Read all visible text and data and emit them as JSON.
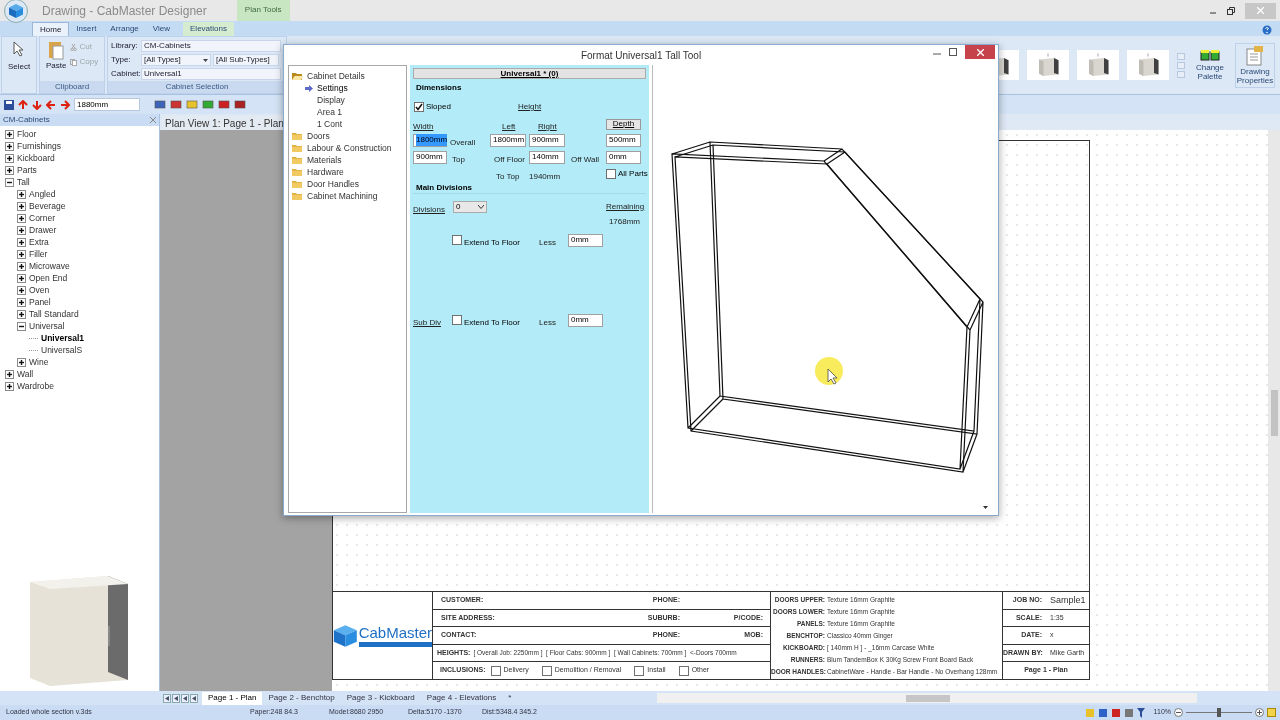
{
  "window": {
    "title": "Drawing - CabMaster Designer",
    "context_tab": "Plan Tools"
  },
  "ribbon_tabs": [
    {
      "label": "Home",
      "selected": true
    },
    {
      "label": "Insert",
      "selected": false
    },
    {
      "label": "Arrange",
      "selected": false
    },
    {
      "label": "View",
      "selected": false
    },
    {
      "label": "Elevations",
      "selected": false
    }
  ],
  "ribbon": {
    "select": "Select",
    "paste": "Paste",
    "cut": "Cut",
    "copy": "Copy",
    "clipboard_group": "Clipboard",
    "library_label": "Library:",
    "library": "CM-Cabinets",
    "type_label": "Type:",
    "type": "[All Types]",
    "subtype": "[All Sub-Types]",
    "cabinet_label": "Cabinet:",
    "cabinet": "Universal1",
    "selection_group": "Cabinet Selection",
    "change_palette": "Change Palette",
    "drawing_properties": "Drawing Properties"
  },
  "toolbar": {
    "size": "1880mm"
  },
  "tree_panel": {
    "title": "CM-Cabinets",
    "items": [
      {
        "label": "Floor",
        "kind": "folder",
        "expanded": false,
        "selected": false
      },
      {
        "label": "Furnishings",
        "kind": "folder",
        "expanded": false,
        "selected": false
      },
      {
        "label": "Kickboard",
        "kind": "folder",
        "expanded": false,
        "selected": false
      },
      {
        "label": "Parts",
        "kind": "folder",
        "expanded": false,
        "selected": false
      },
      {
        "label": "Tall",
        "kind": "folder",
        "expanded": true,
        "selected": false,
        "children": [
          {
            "label": "Angled",
            "kind": "folder",
            "expanded": false,
            "selected": false
          },
          {
            "label": "Beverage",
            "kind": "folder",
            "expanded": false,
            "selected": false
          },
          {
            "label": "Corner",
            "kind": "folder",
            "expanded": false,
            "selected": false
          },
          {
            "label": "Drawer",
            "kind": "folder",
            "expanded": false,
            "selected": false
          },
          {
            "label": "Extra",
            "kind": "folder",
            "expanded": false,
            "selected": false
          },
          {
            "label": "Filler",
            "kind": "folder",
            "expanded": false,
            "selected": false
          },
          {
            "label": "Microwave",
            "kind": "folder",
            "expanded": false,
            "selected": false
          },
          {
            "label": "Open End",
            "kind": "folder",
            "expanded": false,
            "selected": false
          },
          {
            "label": "Oven",
            "kind": "folder",
            "expanded": false,
            "selected": false
          },
          {
            "label": "Panel",
            "kind": "folder",
            "expanded": false,
            "selected": false
          },
          {
            "label": "Tall Standard",
            "kind": "folder",
            "expanded": false,
            "selected": false
          },
          {
            "label": "Universal",
            "kind": "folder",
            "expanded": true,
            "selected": false,
            "children": [
              {
                "label": "Universal1",
                "kind": "cabinet",
                "selected": true
              },
              {
                "label": "UniversalS",
                "kind": "cabinet",
                "selected": false
              }
            ]
          },
          {
            "label": "Wine",
            "kind": "folder",
            "expanded": false,
            "selected": false
          }
        ]
      },
      {
        "label": "Wall",
        "kind": "folder",
        "expanded": false,
        "selected": false
      },
      {
        "label": "Wardrobe",
        "kind": "folder",
        "expanded": false,
        "selected": false
      }
    ]
  },
  "document_tab": "Plan View 1: Page 1 - Plan",
  "dialog": {
    "title": "Format Universal1 Tall Tool",
    "nav": [
      {
        "label": "Cabinet Details",
        "expanded": true,
        "selected": false,
        "children": [
          {
            "label": "Settings",
            "selected": true
          },
          {
            "label": "Display",
            "selected": false
          },
          {
            "label": "Area 1",
            "selected": false
          },
          {
            "label": "1 Cont",
            "selected": false
          }
        ]
      },
      {
        "label": "Doors",
        "expanded": false,
        "selected": false
      },
      {
        "label": "Labour & Construction",
        "expanded": false,
        "selected": false
      },
      {
        "label": "Materials",
        "expanded": false,
        "selected": false
      },
      {
        "label": "Hardware",
        "expanded": false,
        "selected": false
      },
      {
        "label": "Door Handles",
        "expanded": false,
        "selected": false
      },
      {
        "label": "Cabinet Machining",
        "expanded": false,
        "selected": false
      }
    ],
    "form": {
      "header": "Universal1 * (0)",
      "dimensions_heading": "Dimensions",
      "sloped": {
        "label": "Sloped",
        "checked": true
      },
      "height_label": "Height",
      "width_label": "Width",
      "left_label": "Left",
      "right_label": "Right",
      "depth_button": "Depth",
      "width": {
        "value": "1800mm",
        "highlighted": true
      },
      "overall_label": "Overall",
      "left": "1800mm",
      "right": "900mm",
      "depth": "500mm",
      "top": "900mm",
      "top_label": "Top",
      "off_floor_label": "Off Floor",
      "off_floor": "140mm",
      "off_wall_label": "Off Wall",
      "off_wall": "0mm",
      "to_top_label": "To Top",
      "to_top": "1940mm",
      "all_parts": {
        "label": "All Parts",
        "checked": false
      },
      "main_divisions_heading": "Main Divisions",
      "divisions_label": "Divisions",
      "divisions": "0",
      "remaining_label": "Remaining",
      "remaining": "1768mm",
      "main_extend": {
        "label": "Extend To Floor",
        "checked": false
      },
      "main_less_label": "Less",
      "main_less": "0mm",
      "sub_div_label": "Sub Div",
      "sub_extend": {
        "label": "Extend To Floor",
        "checked": false
      },
      "sub_less_label": "Less",
      "sub_less": "0mm"
    }
  },
  "title_block": {
    "logo": "CabMaster",
    "info_rows": [
      [
        {
          "label": "CUSTOMER:"
        },
        {
          "label": "PHONE:"
        }
      ],
      [
        {
          "label": "SITE ADDRESS:"
        },
        {
          "label": "SUBURB:"
        },
        {
          "label": "P/CODE:"
        }
      ],
      [
        {
          "label": "CONTACT:"
        },
        {
          "label": "PHONE:"
        },
        {
          "label": "MOB:"
        }
      ]
    ],
    "heights_label": "HEIGHTS:",
    "heights": "[ Overall Job: 2250mm ]  [ Floor Cabs: 900mm ]  [ Wall Cabinets: 700mm ]  <-Doors 700mm",
    "inclusions_label": "INCLUSIONS:",
    "inclusions": [
      {
        "label": "Delivery",
        "checked": false
      },
      {
        "label": "Demolition / Removal",
        "checked": false
      },
      {
        "label": "Install",
        "checked": false
      },
      {
        "label": "Other",
        "checked": false
      }
    ],
    "specs": [
      {
        "label": "DOORS UPPER:",
        "value": "Texture 16mm Graphite"
      },
      {
        "label": "DOORS LOWER:",
        "value": "Texture 16mm Graphite"
      },
      {
        "label": "PANELS:",
        "value": "Texture 16mm Graphite"
      },
      {
        "label": "BENCHTOP:",
        "value": "Classico 40mm Ginger"
      },
      {
        "label": "KICKBOARD:",
        "value": "[ 140mm H ] - _16mm Carcase White"
      },
      {
        "label": "RUNNERS:",
        "value": "Blum TandemBox K 30Kg Screw Front Board Back"
      },
      {
        "label": "DOOR HANDLES:",
        "value": "CabinetWare - Handle - Bar Handle - No Overhang 128mm"
      }
    ],
    "job": [
      {
        "label": "JOB NO:",
        "value": "Sample1"
      },
      {
        "label": "SCALE:",
        "value": "1:35"
      },
      {
        "label": "DATE:",
        "value": "x"
      },
      {
        "label": "DRAWN BY:",
        "value": "Mike Garth"
      }
    ],
    "page_name": "Page 1 - Plan"
  },
  "page_tabs": [
    {
      "label": "Page 1 - Plan",
      "selected": true
    },
    {
      "label": "Page 2 - Benchtop",
      "selected": false
    },
    {
      "label": "Page 3 - Kickboard",
      "selected": false
    },
    {
      "label": "Page 4 - Elevations",
      "selected": false
    },
    {
      "label": "*",
      "selected": false
    }
  ],
  "status_bar": {
    "message": "Loaded whole section v.3ds",
    "paper": "Paper:248 84.3",
    "model": "Model:8680 2950",
    "delta": "Delta:5170 -1370",
    "dist": "Dist:5348.4 345.2",
    "zoom": "110%",
    "zoom_slider": {
      "level": 0.5
    }
  }
}
